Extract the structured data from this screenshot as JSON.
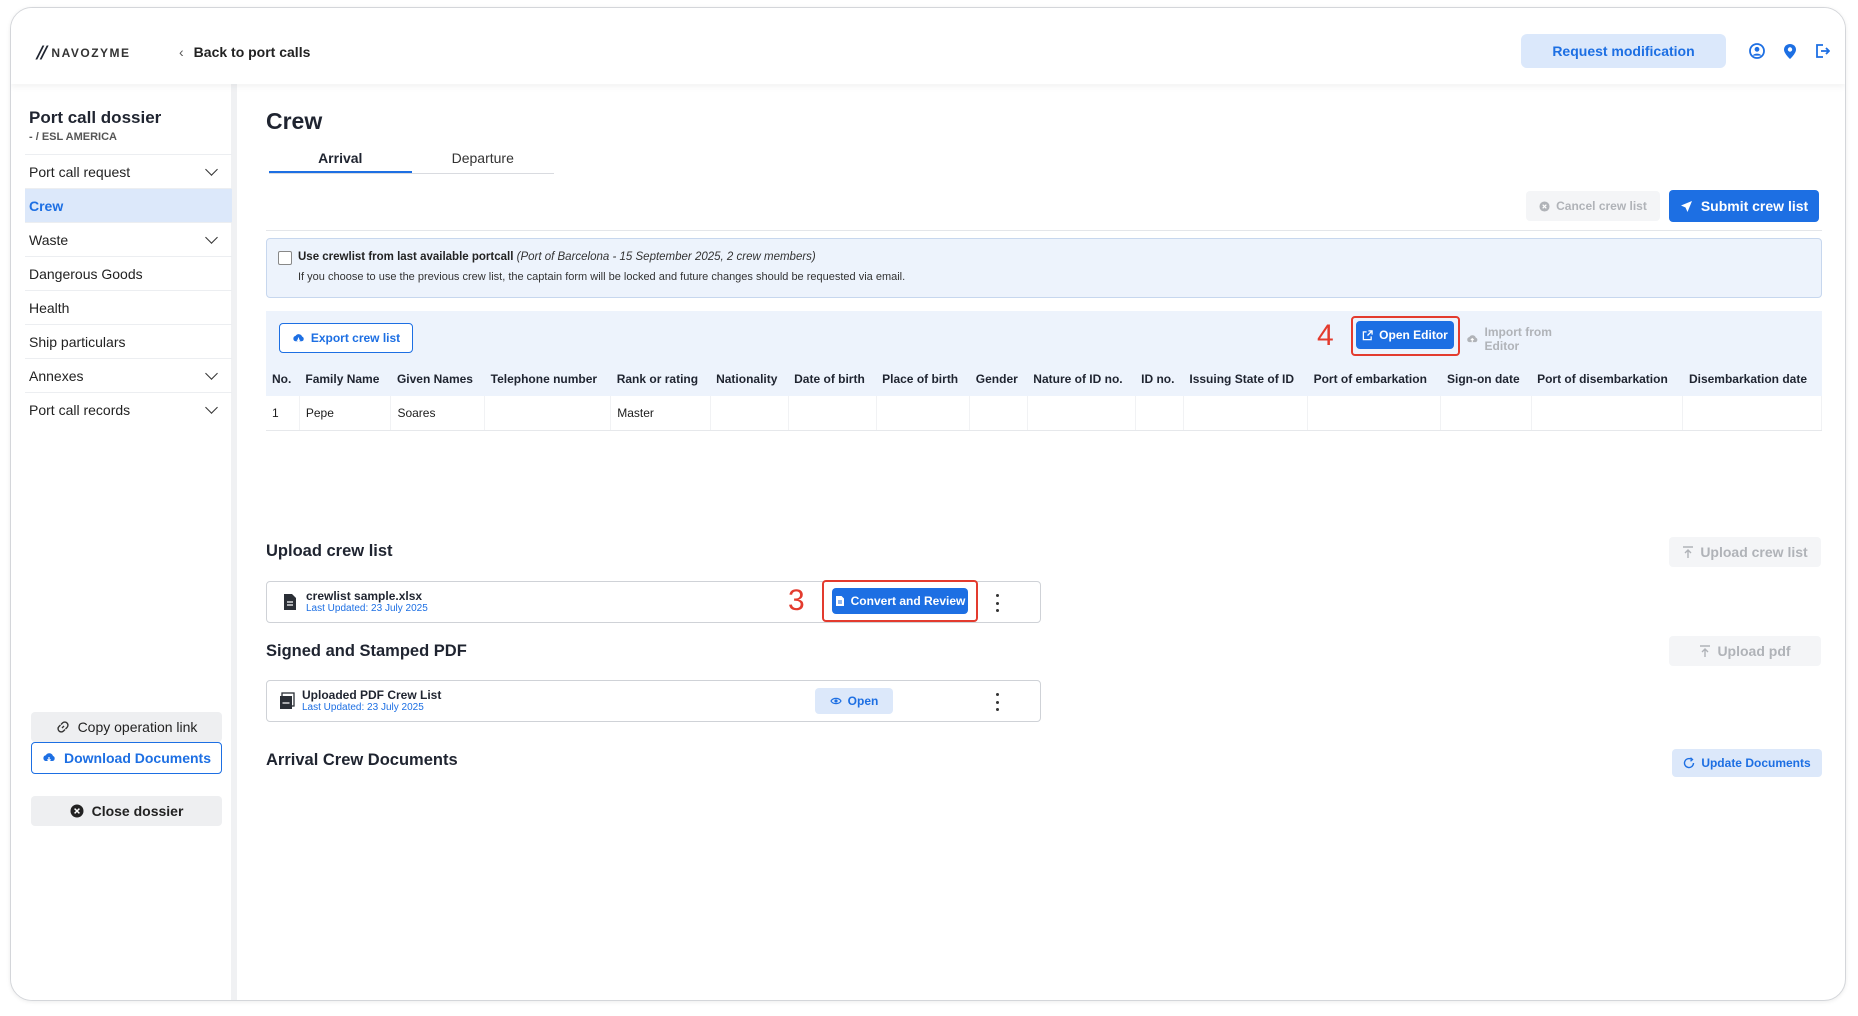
{
  "header": {
    "logo_text": "NAVOZYME",
    "back_label": "Back to port calls",
    "request_modification_label": "Request modification"
  },
  "sidebar": {
    "title": "Port call dossier",
    "subtitle": "- / ESL AMERICA",
    "items": [
      {
        "label": "Port call request",
        "expandable": true,
        "active": false
      },
      {
        "label": "Crew",
        "expandable": false,
        "active": true
      },
      {
        "label": "Waste",
        "expandable": true,
        "active": false
      },
      {
        "label": "Dangerous Goods",
        "expandable": false,
        "active": false
      },
      {
        "label": "Health",
        "expandable": false,
        "active": false
      },
      {
        "label": "Ship particulars",
        "expandable": false,
        "active": false
      },
      {
        "label": "Annexes",
        "expandable": true,
        "active": false
      },
      {
        "label": "Port call records",
        "expandable": true,
        "active": false
      }
    ],
    "copy_link_label": "Copy operation link",
    "download_label": "Download Documents",
    "close_label": "Close dossier"
  },
  "main": {
    "title": "Crew",
    "tabs": [
      {
        "label": "Arrival",
        "active": true
      },
      {
        "label": "Departure",
        "active": false
      }
    ],
    "cancel_label": "Cancel crew list",
    "submit_label": "Submit crew list",
    "info": {
      "checkbox_label": "Use crewlist from last available portcall",
      "detail": "(Port of Barcelona - 15 September 2025, 2 crew members)",
      "note": "If you choose to use the previous crew list, the captain form will be locked and future changes should be requested via email."
    },
    "export_label": "Export crew list",
    "open_editor_label": "Open Editor",
    "import_label": "Import from Editor",
    "table": {
      "columns": [
        "No.",
        "Family Name",
        "Given Names",
        "Telephone number",
        "Rank or rating",
        "Nationality",
        "Date of birth",
        "Place of birth",
        "Gender",
        "Nature of ID no.",
        "ID no.",
        "Issuing State of ID",
        "Port of embarkation",
        "Sign-on date",
        "Port of disembarkation",
        "Disembarkation date"
      ],
      "rows": [
        [
          "1",
          "Pepe",
          "Soares",
          "",
          "Master",
          "",
          "",
          "",
          "",
          "",
          "",
          "",
          "",
          "",
          "",
          ""
        ]
      ]
    },
    "upload_section": {
      "title": "Upload crew list",
      "upload_label": "Upload crew list",
      "file_name": "crewlist sample.xlsx",
      "file_date": "Last Updated: 23 July 2025",
      "convert_label": "Convert and Review"
    },
    "pdf_section": {
      "title": "Signed and Stamped PDF",
      "upload_label": "Upload pdf",
      "file_name": "Uploaded PDF Crew List",
      "file_date": "Last Updated: 23 July 2025",
      "open_label": "Open"
    },
    "documents_section": {
      "title": "Arrival Crew Documents",
      "update_label": "Update Documents"
    },
    "annotations": {
      "open_editor": "4",
      "convert": "3"
    }
  },
  "colors": {
    "accent": "#1d6fe3",
    "accent_light": "#dce8fa",
    "annotation": "#e33b2e"
  }
}
